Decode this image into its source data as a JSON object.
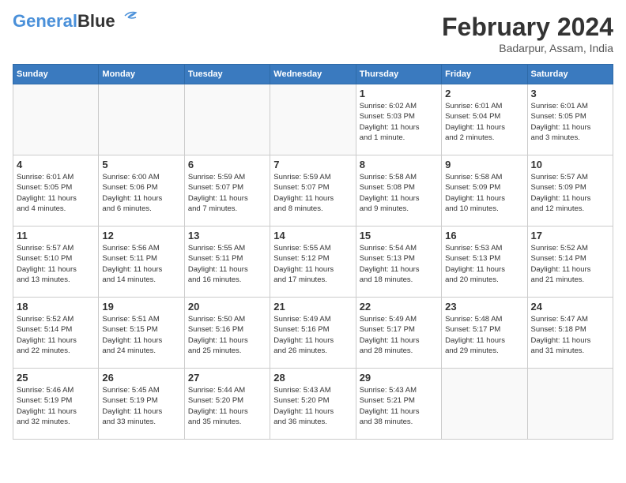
{
  "header": {
    "logo_line1": "General",
    "logo_line2": "Blue",
    "month_year": "February 2024",
    "location": "Badarpur, Assam, India"
  },
  "weekdays": [
    "Sunday",
    "Monday",
    "Tuesday",
    "Wednesday",
    "Thursday",
    "Friday",
    "Saturday"
  ],
  "weeks": [
    [
      {
        "day": "",
        "empty": true
      },
      {
        "day": "",
        "empty": true
      },
      {
        "day": "",
        "empty": true
      },
      {
        "day": "",
        "empty": true
      },
      {
        "day": "1",
        "sunrise": "Sunrise: 6:02 AM",
        "sunset": "Sunset: 5:03 PM",
        "daylight": "Daylight: 11 hours and 1 minute."
      },
      {
        "day": "2",
        "sunrise": "Sunrise: 6:01 AM",
        "sunset": "Sunset: 5:04 PM",
        "daylight": "Daylight: 11 hours and 2 minutes."
      },
      {
        "day": "3",
        "sunrise": "Sunrise: 6:01 AM",
        "sunset": "Sunset: 5:05 PM",
        "daylight": "Daylight: 11 hours and 3 minutes."
      }
    ],
    [
      {
        "day": "4",
        "sunrise": "Sunrise: 6:01 AM",
        "sunset": "Sunset: 5:05 PM",
        "daylight": "Daylight: 11 hours and 4 minutes."
      },
      {
        "day": "5",
        "sunrise": "Sunrise: 6:00 AM",
        "sunset": "Sunset: 5:06 PM",
        "daylight": "Daylight: 11 hours and 6 minutes."
      },
      {
        "day": "6",
        "sunrise": "Sunrise: 5:59 AM",
        "sunset": "Sunset: 5:07 PM",
        "daylight": "Daylight: 11 hours and 7 minutes."
      },
      {
        "day": "7",
        "sunrise": "Sunrise: 5:59 AM",
        "sunset": "Sunset: 5:07 PM",
        "daylight": "Daylight: 11 hours and 8 minutes."
      },
      {
        "day": "8",
        "sunrise": "Sunrise: 5:58 AM",
        "sunset": "Sunset: 5:08 PM",
        "daylight": "Daylight: 11 hours and 9 minutes."
      },
      {
        "day": "9",
        "sunrise": "Sunrise: 5:58 AM",
        "sunset": "Sunset: 5:09 PM",
        "daylight": "Daylight: 11 hours and 10 minutes."
      },
      {
        "day": "10",
        "sunrise": "Sunrise: 5:57 AM",
        "sunset": "Sunset: 5:09 PM",
        "daylight": "Daylight: 11 hours and 12 minutes."
      }
    ],
    [
      {
        "day": "11",
        "sunrise": "Sunrise: 5:57 AM",
        "sunset": "Sunset: 5:10 PM",
        "daylight": "Daylight: 11 hours and 13 minutes."
      },
      {
        "day": "12",
        "sunrise": "Sunrise: 5:56 AM",
        "sunset": "Sunset: 5:11 PM",
        "daylight": "Daylight: 11 hours and 14 minutes."
      },
      {
        "day": "13",
        "sunrise": "Sunrise: 5:55 AM",
        "sunset": "Sunset: 5:11 PM",
        "daylight": "Daylight: 11 hours and 16 minutes."
      },
      {
        "day": "14",
        "sunrise": "Sunrise: 5:55 AM",
        "sunset": "Sunset: 5:12 PM",
        "daylight": "Daylight: 11 hours and 17 minutes."
      },
      {
        "day": "15",
        "sunrise": "Sunrise: 5:54 AM",
        "sunset": "Sunset: 5:13 PM",
        "daylight": "Daylight: 11 hours and 18 minutes."
      },
      {
        "day": "16",
        "sunrise": "Sunrise: 5:53 AM",
        "sunset": "Sunset: 5:13 PM",
        "daylight": "Daylight: 11 hours and 20 minutes."
      },
      {
        "day": "17",
        "sunrise": "Sunrise: 5:52 AM",
        "sunset": "Sunset: 5:14 PM",
        "daylight": "Daylight: 11 hours and 21 minutes."
      }
    ],
    [
      {
        "day": "18",
        "sunrise": "Sunrise: 5:52 AM",
        "sunset": "Sunset: 5:14 PM",
        "daylight": "Daylight: 11 hours and 22 minutes."
      },
      {
        "day": "19",
        "sunrise": "Sunrise: 5:51 AM",
        "sunset": "Sunset: 5:15 PM",
        "daylight": "Daylight: 11 hours and 24 minutes."
      },
      {
        "day": "20",
        "sunrise": "Sunrise: 5:50 AM",
        "sunset": "Sunset: 5:16 PM",
        "daylight": "Daylight: 11 hours and 25 minutes."
      },
      {
        "day": "21",
        "sunrise": "Sunrise: 5:49 AM",
        "sunset": "Sunset: 5:16 PM",
        "daylight": "Daylight: 11 hours and 26 minutes."
      },
      {
        "day": "22",
        "sunrise": "Sunrise: 5:49 AM",
        "sunset": "Sunset: 5:17 PM",
        "daylight": "Daylight: 11 hours and 28 minutes."
      },
      {
        "day": "23",
        "sunrise": "Sunrise: 5:48 AM",
        "sunset": "Sunset: 5:17 PM",
        "daylight": "Daylight: 11 hours and 29 minutes."
      },
      {
        "day": "24",
        "sunrise": "Sunrise: 5:47 AM",
        "sunset": "Sunset: 5:18 PM",
        "daylight": "Daylight: 11 hours and 31 minutes."
      }
    ],
    [
      {
        "day": "25",
        "sunrise": "Sunrise: 5:46 AM",
        "sunset": "Sunset: 5:19 PM",
        "daylight": "Daylight: 11 hours and 32 minutes."
      },
      {
        "day": "26",
        "sunrise": "Sunrise: 5:45 AM",
        "sunset": "Sunset: 5:19 PM",
        "daylight": "Daylight: 11 hours and 33 minutes."
      },
      {
        "day": "27",
        "sunrise": "Sunrise: 5:44 AM",
        "sunset": "Sunset: 5:20 PM",
        "daylight": "Daylight: 11 hours and 35 minutes."
      },
      {
        "day": "28",
        "sunrise": "Sunrise: 5:43 AM",
        "sunset": "Sunset: 5:20 PM",
        "daylight": "Daylight: 11 hours and 36 minutes."
      },
      {
        "day": "29",
        "sunrise": "Sunrise: 5:43 AM",
        "sunset": "Sunset: 5:21 PM",
        "daylight": "Daylight: 11 hours and 38 minutes."
      },
      {
        "day": "",
        "empty": true
      },
      {
        "day": "",
        "empty": true
      }
    ]
  ]
}
